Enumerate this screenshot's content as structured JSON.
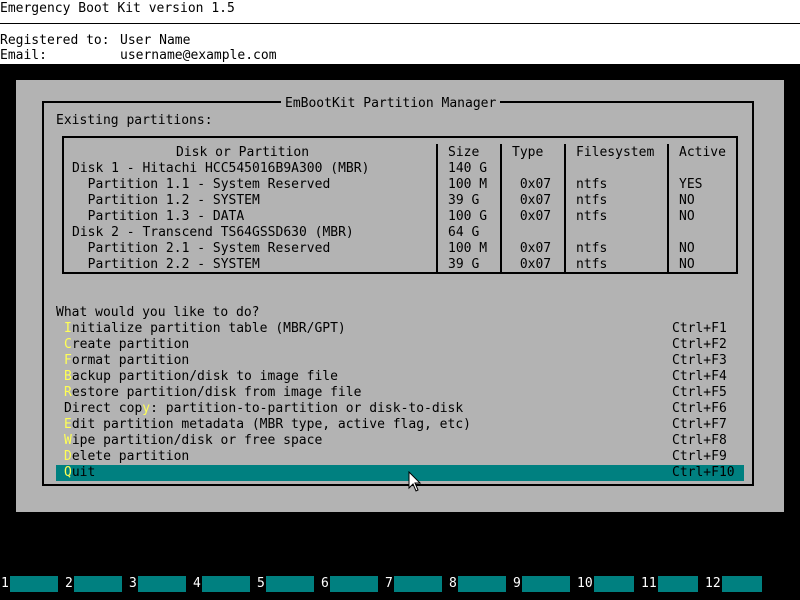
{
  "header": {
    "title": "Emergency Boot Kit version 1.5",
    "registered_label": "Registered to:",
    "registered_value": "User Name",
    "email_label": "Email:",
    "email_value": "username@example.com"
  },
  "dialog": {
    "title": "EmBootKit Partition Manager",
    "existing_label": "Existing partitions:",
    "table": {
      "columns": [
        "Disk or Partition",
        "Size",
        "Type",
        "Filesystem",
        "Active"
      ],
      "rows": [
        {
          "name": "Disk 1 - Hitachi HCC545016B9A300 (MBR)",
          "size": "140 G",
          "type": "",
          "fs": "",
          "active": ""
        },
        {
          "name": "  Partition 1.1 - System Reserved",
          "size": "100 M",
          "type": " 0x07",
          "fs": "ntfs",
          "active": "YES"
        },
        {
          "name": "  Partition 1.2 - SYSTEM",
          "size": "39 G",
          "type": " 0x07",
          "fs": "ntfs",
          "active": "NO"
        },
        {
          "name": "  Partition 1.3 - DATA",
          "size": "100 G",
          "type": " 0x07",
          "fs": "ntfs",
          "active": "NO"
        },
        {
          "name": "Disk 2 - Transcend TS64GSSD630 (MBR)",
          "size": "64 G",
          "type": "",
          "fs": "",
          "active": ""
        },
        {
          "name": "  Partition 2.1 - System Reserved",
          "size": "100 M",
          "type": " 0x07",
          "fs": "ntfs",
          "active": "NO"
        },
        {
          "name": "  Partition 2.2 - SYSTEM",
          "size": "39 G",
          "type": " 0x07",
          "fs": "ntfs",
          "active": "NO"
        }
      ]
    },
    "prompt": "What would you like to do?",
    "menu": [
      {
        "hotkey": "I",
        "rest": "nitialize partition table (MBR/GPT)",
        "shortcut": "Ctrl+F1"
      },
      {
        "hotkey": "C",
        "rest": "reate partition",
        "shortcut": "Ctrl+F2"
      },
      {
        "hotkey": "F",
        "rest": "ormat partition",
        "shortcut": "Ctrl+F3"
      },
      {
        "hotkey": "B",
        "rest": "ackup partition/disk to image file",
        "shortcut": "Ctrl+F4"
      },
      {
        "hotkey": "R",
        "rest": "estore partition/disk from image file",
        "shortcut": "Ctrl+F5"
      },
      {
        "pre": "Direct cop",
        "hotkey": "y",
        "rest": ": partition-to-partition or disk-to-disk",
        "shortcut": "Ctrl+F6"
      },
      {
        "hotkey": "E",
        "rest": "dit partition metadata (MBR type, active flag, etc)",
        "shortcut": "Ctrl+F7"
      },
      {
        "hotkey": "W",
        "rest": "ipe partition/disk or free space",
        "shortcut": "Ctrl+F8"
      },
      {
        "hotkey": "D",
        "rest": "elete partition",
        "shortcut": "Ctrl+F9"
      },
      {
        "hotkey": "Q",
        "rest": "uit",
        "shortcut": "Ctrl+F10"
      }
    ]
  },
  "fkeys": [
    "1",
    "2",
    "3",
    "4",
    "5",
    "6",
    "7",
    "8",
    "9",
    "10",
    "11",
    "12"
  ],
  "colors": {
    "teal": "#008080",
    "gray": "#b3b3b3",
    "hotkey": "#ffff55"
  }
}
